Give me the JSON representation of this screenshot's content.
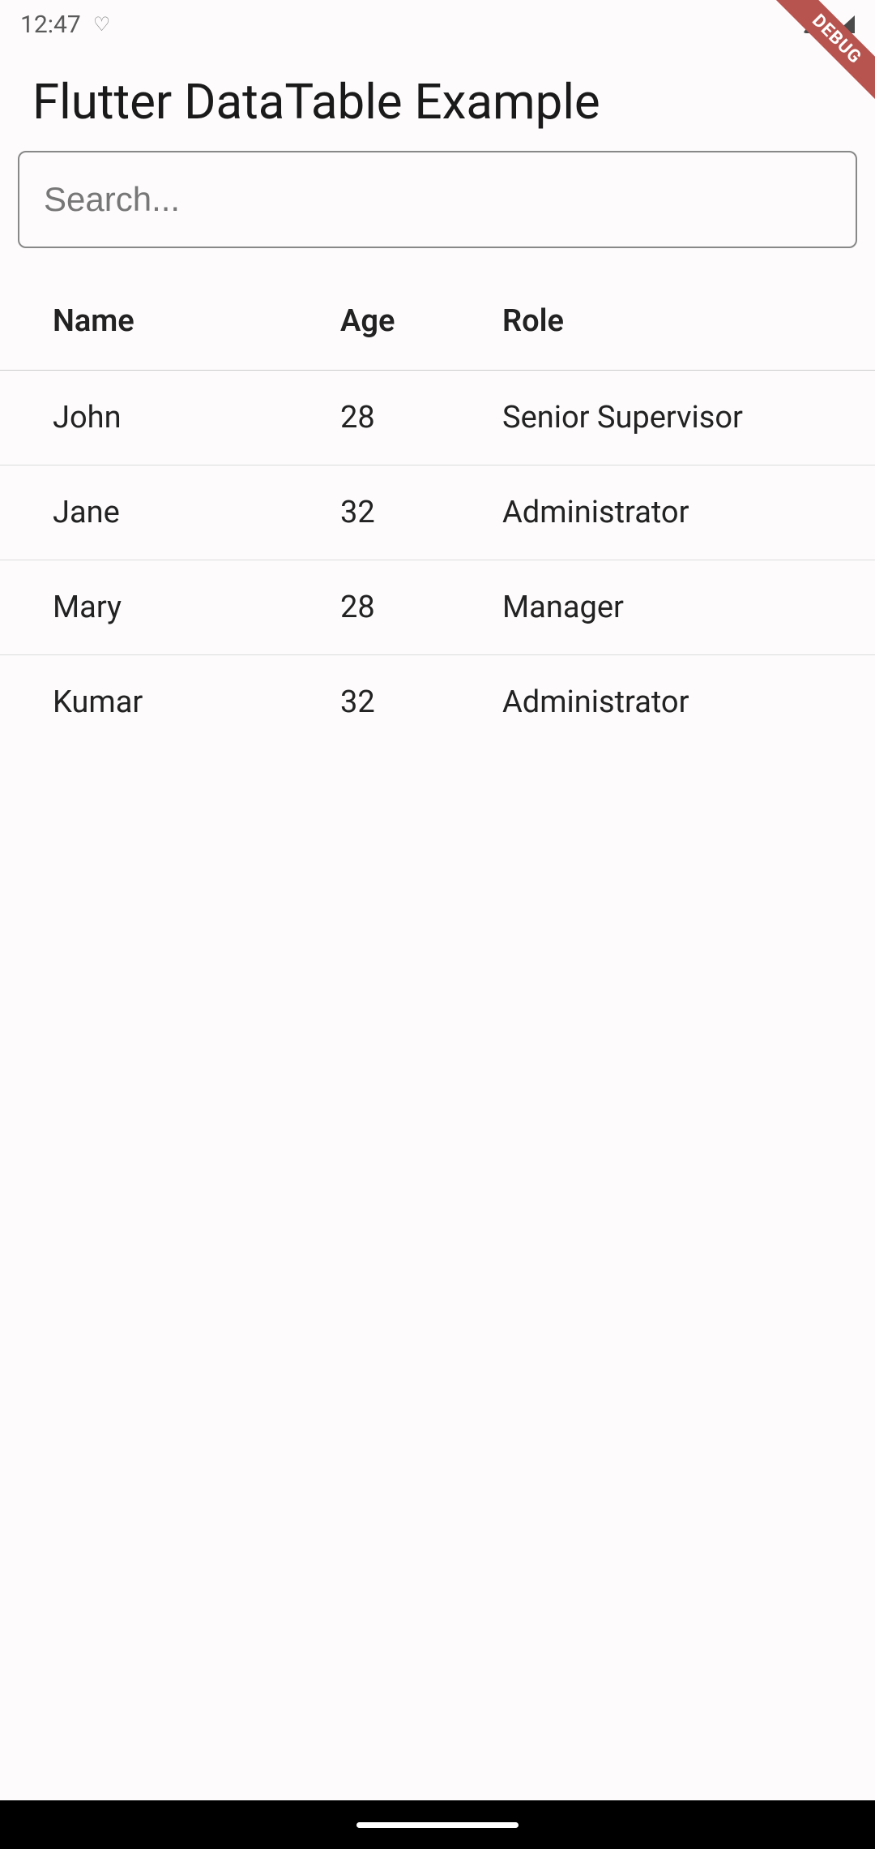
{
  "status_bar": {
    "time": "12:47",
    "heart_glyph": "♡"
  },
  "debug_banner": "DEBUG",
  "page": {
    "title": "Flutter DataTable Example"
  },
  "search": {
    "placeholder": "Search...",
    "value": ""
  },
  "table": {
    "columns": {
      "name": "Name",
      "age": "Age",
      "role": "Role"
    },
    "rows": [
      {
        "name": "John",
        "age": "28",
        "role": "Senior Supervisor"
      },
      {
        "name": "Jane",
        "age": "32",
        "role": "Administrator"
      },
      {
        "name": "Mary",
        "age": "28",
        "role": "Manager"
      },
      {
        "name": "Kumar",
        "age": "32",
        "role": "Administrator"
      }
    ]
  }
}
